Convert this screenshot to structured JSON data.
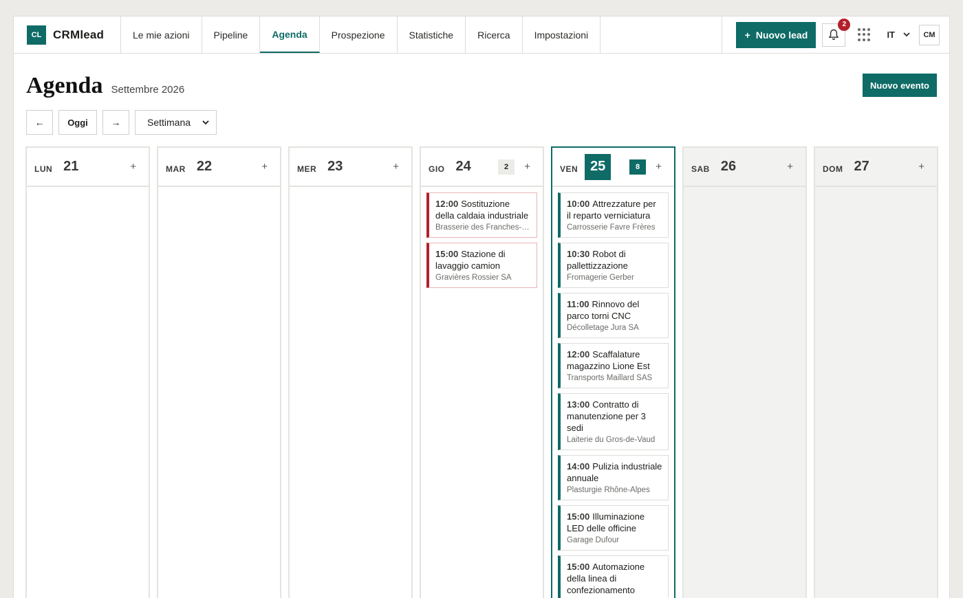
{
  "brand": {
    "logo": "CL",
    "name": "CRMlead"
  },
  "nav": [
    {
      "label": "Le mie azioni",
      "active": false
    },
    {
      "label": "Pipeline",
      "active": false
    },
    {
      "label": "Agenda",
      "active": true
    },
    {
      "label": "Prospezione",
      "active": false
    },
    {
      "label": "Statistiche",
      "active": false
    },
    {
      "label": "Ricerca",
      "active": false
    },
    {
      "label": "Impostazioni",
      "active": false
    }
  ],
  "header_actions": {
    "new_lead_label": "Nuovo lead",
    "new_lead_icon": "+",
    "notifications_count": "2",
    "language": "IT",
    "avatar_initials": "CM"
  },
  "page": {
    "title": "Agenda",
    "subtitle": "Settembre 2026",
    "new_event_label": "Nuovo evento",
    "prev_label": "←",
    "today_label": "Oggi",
    "next_label": "→",
    "view_value": "Settimana"
  },
  "colors": {
    "accent": "#0e6b66",
    "overdue": "#b3202a",
    "background": "#ecebe7"
  },
  "days": [
    {
      "name": "LUN",
      "num": "21",
      "count": "",
      "today": false,
      "weekend": false,
      "events": []
    },
    {
      "name": "MAR",
      "num": "22",
      "count": "",
      "today": false,
      "weekend": false,
      "events": []
    },
    {
      "name": "MER",
      "num": "23",
      "count": "",
      "today": false,
      "weekend": false,
      "events": []
    },
    {
      "name": "GIO",
      "num": "24",
      "count": "2",
      "today": false,
      "weekend": false,
      "events": [
        {
          "time": "12:00",
          "title": "Sostituzione della caldaia industriale",
          "client": "Brasserie des Franches-Montagnes",
          "overdue": true
        },
        {
          "time": "15:00",
          "title": "Stazione di lavaggio camion",
          "client": "Gravières Rossier SA",
          "overdue": true
        }
      ]
    },
    {
      "name": "VEN",
      "num": "25",
      "count": "8",
      "today": true,
      "weekend": false,
      "events": [
        {
          "time": "10:00",
          "title": "Attrezzature per il reparto verniciatura",
          "client": "Carrosserie Favre Frères",
          "overdue": false
        },
        {
          "time": "10:30",
          "title": "Robot di pallettizzazione",
          "client": "Fromagerie Gerber",
          "overdue": false
        },
        {
          "time": "11:00",
          "title": "Rinnovo del parco torni CNC",
          "client": "Décolletage Jura SA",
          "overdue": false
        },
        {
          "time": "12:00",
          "title": "Scaffalature magazzino Lione Est",
          "client": "Transports Maillard SAS",
          "overdue": false
        },
        {
          "time": "13:00",
          "title": "Contratto di manutenzione per 3 sedi",
          "client": "Laiterie du Gros-de-Vaud",
          "overdue": false
        },
        {
          "time": "14:00",
          "title": "Pulizia industriale annuale",
          "client": "Plasturgie Rhône-Alpes",
          "overdue": false
        },
        {
          "time": "15:00",
          "title": "Illuminazione LED delle officine",
          "client": "Garage Dufour",
          "overdue": false
        },
        {
          "time": "15:00",
          "title": "Automazione della linea di confezionamento",
          "client": "",
          "overdue": false
        }
      ]
    },
    {
      "name": "SAB",
      "num": "26",
      "count": "",
      "today": false,
      "weekend": true,
      "events": []
    },
    {
      "name": "DOM",
      "num": "27",
      "count": "",
      "today": false,
      "weekend": true,
      "events": []
    }
  ]
}
